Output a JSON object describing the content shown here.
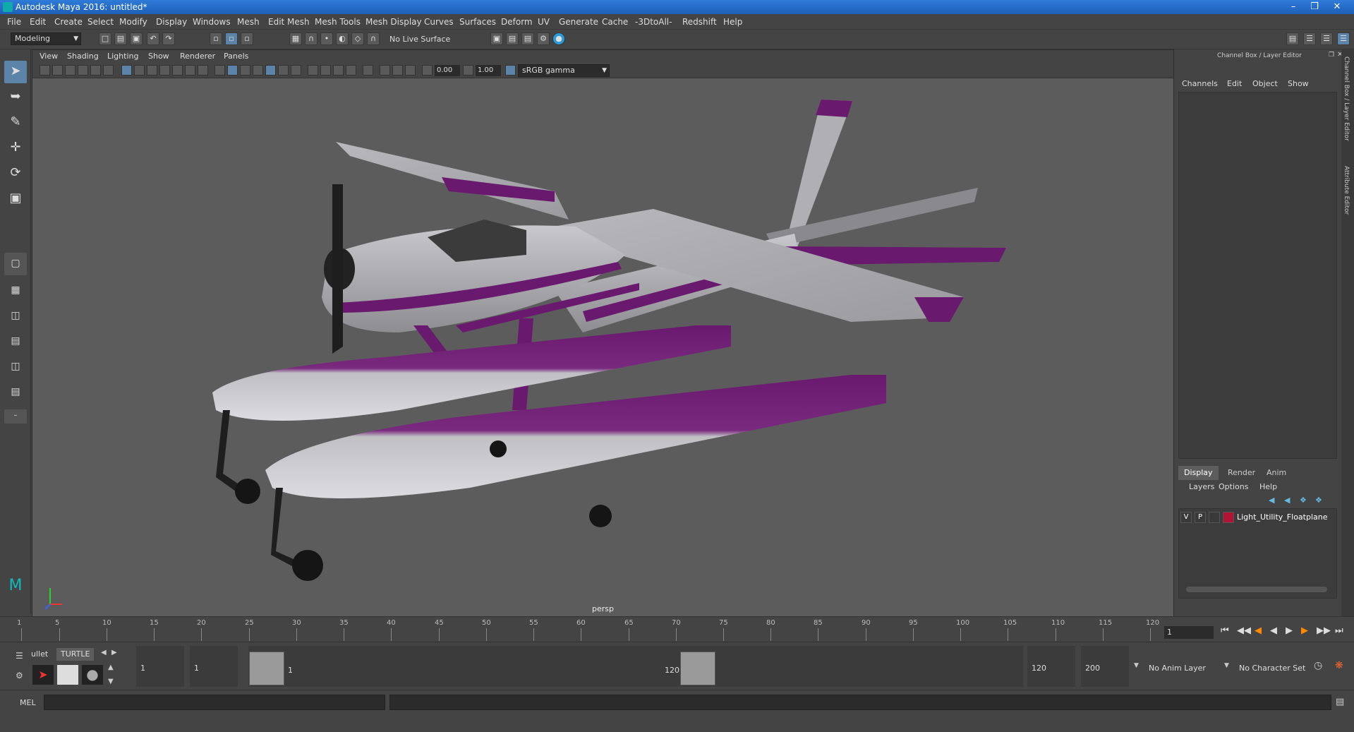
{
  "window": {
    "title": "Autodesk Maya 2016: untitled*"
  },
  "menu": [
    "File",
    "Edit",
    "Create",
    "Select",
    "Modify",
    "Display",
    "Windows",
    "Mesh",
    "Edit Mesh",
    "Mesh Tools",
    "Mesh Display",
    "Curves",
    "Surfaces",
    "Deform",
    "UV",
    "Generate",
    "Cache",
    "-3DtoAll-",
    "Redshift",
    "Help"
  ],
  "status": {
    "mode": "Modeling",
    "live_surface": "No Live Surface"
  },
  "panel": {
    "menu": [
      "View",
      "Shading",
      "Lighting",
      "Show",
      "Renderer",
      "Panels"
    ],
    "exposure": "0.00",
    "gamma": "1.00",
    "color_space": "sRGB gamma",
    "camera_label": "persp"
  },
  "channel_box": {
    "title": "Channel Box / Layer Editor",
    "menu": [
      "Channels",
      "Edit",
      "Object",
      "Show"
    ],
    "side_tabs": [
      "Channel Box / Layer Editor",
      "Attribute Editor"
    ]
  },
  "layer_editor": {
    "tabs": [
      "Display",
      "Render",
      "Anim"
    ],
    "selected_tab": "Display",
    "menu": [
      "Layers",
      "Options",
      "Help"
    ],
    "layers": [
      {
        "v": "V",
        "p": "P",
        "color": "#b01535",
        "name": "Light_Utility_Floatplane"
      }
    ]
  },
  "timeline": {
    "ticks": [
      1,
      5,
      10,
      15,
      20,
      25,
      30,
      35,
      40,
      45,
      50,
      55,
      60,
      65,
      70,
      75,
      80,
      85,
      90,
      95,
      100,
      105,
      110,
      115,
      120
    ],
    "current_frame": "1"
  },
  "range": {
    "shelf_tabs": [
      "ullet",
      "TURTLE"
    ],
    "start": "1",
    "playback_start": "1",
    "range_start_label": "1",
    "range_end_label": "120",
    "playback_end": "120",
    "end": "200",
    "anim_layer": "No Anim Layer",
    "character_set": "No Character Set"
  },
  "command_line": {
    "label": "MEL"
  },
  "colors": {
    "accent": "#5b84a8",
    "layer_red": "#b01535",
    "plane_purple": "#6a1a6e",
    "plane_gray": "#a8a8ac"
  }
}
